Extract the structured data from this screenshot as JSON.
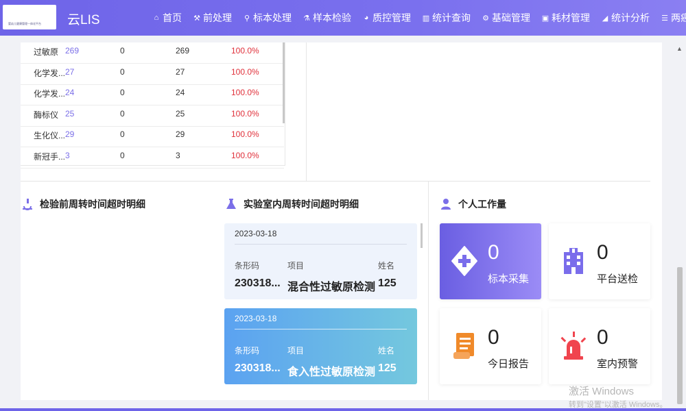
{
  "header": {
    "logo_text": "婴幼儿健康管理一体化平台",
    "app_title": "云LIS",
    "nav": [
      {
        "label": "首页",
        "icon": "home-icon",
        "glyph": "⌂"
      },
      {
        "label": "前处理",
        "icon": "wrench-icon",
        "glyph": "⚒"
      },
      {
        "label": "标本处理",
        "icon": "sample-tube-icon",
        "glyph": "⚲"
      },
      {
        "label": "样本检验",
        "icon": "flask-icon",
        "glyph": "⚗"
      },
      {
        "label": "质控管理",
        "icon": "pie-chart-icon",
        "glyph": "◕"
      },
      {
        "label": "统计查询",
        "icon": "bar-chart-icon",
        "glyph": "▥"
      },
      {
        "label": "基础管理",
        "icon": "gear-icon",
        "glyph": "⚙"
      },
      {
        "label": "耗材管理",
        "icon": "briefcase-icon",
        "glyph": "▣"
      },
      {
        "label": "统计分析",
        "icon": "area-chart-icon",
        "glyph": "◢"
      },
      {
        "label": "两癌筛查",
        "icon": "list-icon",
        "glyph": "☰"
      }
    ]
  },
  "stats_table": {
    "rows": [
      {
        "name": "过敏原",
        "total": "269",
        "overdue": "0",
        "ok": "269",
        "rate": "100.0%"
      },
      {
        "name": "化学发...",
        "total": "27",
        "overdue": "0",
        "ok": "27",
        "rate": "100.0%"
      },
      {
        "name": "化学发...",
        "total": "24",
        "overdue": "0",
        "ok": "24",
        "rate": "100.0%"
      },
      {
        "name": "酶标仪",
        "total": "25",
        "overdue": "0",
        "ok": "25",
        "rate": "100.0%"
      },
      {
        "name": "生化仪...",
        "total": "29",
        "overdue": "0",
        "ok": "29",
        "rate": "100.0%"
      },
      {
        "name": "新冠手...",
        "total": "3",
        "overdue": "0",
        "ok": "3",
        "rate": "100.0%"
      }
    ]
  },
  "sections": {
    "pre_lab_title": "检验前周转时间超时明细",
    "in_lab_title": "实验室内周转时间超时明细",
    "workload_title": "个人工作量"
  },
  "lab_cards": [
    {
      "date": "2023-03-18",
      "barcode_label": "条形码",
      "item_label": "项目",
      "name_label": "姓名",
      "barcode": "230318...",
      "item": "混合性过敏原检测",
      "name": "125"
    },
    {
      "date": "2023-03-18",
      "barcode_label": "条形码",
      "item_label": "项目",
      "name_label": "姓名",
      "barcode": "230318...",
      "item": "食入性过敏原检测",
      "name": "125"
    }
  ],
  "workload": [
    {
      "value": "0",
      "label": "标本采集",
      "icon": "medical-cross-icon"
    },
    {
      "value": "0",
      "label": "平台送检",
      "icon": "hospital-icon"
    },
    {
      "value": "0",
      "label": "今日报告",
      "icon": "scroll-report-icon"
    },
    {
      "value": "0",
      "label": "室内预警",
      "icon": "alarm-light-icon"
    }
  ],
  "watermark": {
    "line1": "激活 Windows",
    "line2": "转到\"设置\"以激活 Windows。"
  },
  "colors": {
    "header": "#6e64e8",
    "accent_purple": "#7b6fe8",
    "rate_red": "#e0303a",
    "card_blue_start": "#5ba2f1",
    "card_blue_end": "#74c8de",
    "icon_orange": "#f08a2a",
    "icon_red": "#f0444e"
  }
}
